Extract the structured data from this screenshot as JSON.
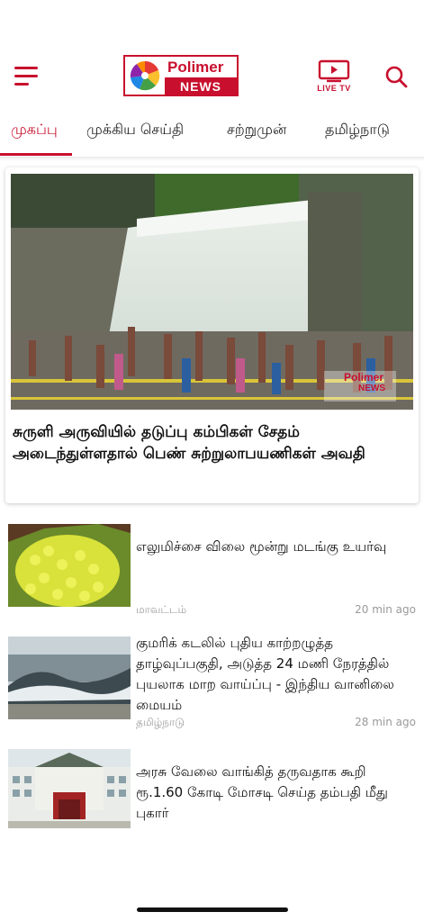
{
  "header": {
    "logo_top": "Polimer",
    "logo_bottom": "NEWS",
    "live_tv_label": "LIVE TV",
    "brand_color": "#c8102e",
    "icons": [
      "menu-icon",
      "live-tv-icon",
      "search-icon"
    ]
  },
  "tabs": [
    {
      "label": "முகப்பு",
      "active": true
    },
    {
      "label": "முக்கிய செய்தி",
      "active": false
    },
    {
      "label": "சற்றுமுன்",
      "active": false
    },
    {
      "label": "தமிழ்நாடு",
      "active": false
    }
  ],
  "featured": {
    "title": "சுருளி அருவியில் தடுப்பு கம்பிகள் சேதம் அடைந்துள்ளதால் பெண் சுற்றுலாபயணிகள் அவதி",
    "watermark_top": "Polimer",
    "watermark_bottom": "NEWS"
  },
  "news": [
    {
      "title": "எலுமிச்சை விலை மூன்று மடங்கு உயர்வு",
      "category": "மாவட்டம்",
      "time": "20 min ago"
    },
    {
      "title": "குமரிக் கடலில் புதிய காற்றழுத்த தாழ்வுப்பகுதி, அடுத்த 24 மணி நேரத்தில் புயலாக மாற வாய்ப்பு - இந்திய வானிலை மையம்",
      "category": "தமிழ்நாடு",
      "time": "28 min ago"
    },
    {
      "title": "அரசு வேலை வாங்கித் தருவதாக கூறி ரூ.1.60 கோடி மோசடி செய்த தம்பதி மீது புகார்",
      "category": "",
      "time": ""
    }
  ]
}
